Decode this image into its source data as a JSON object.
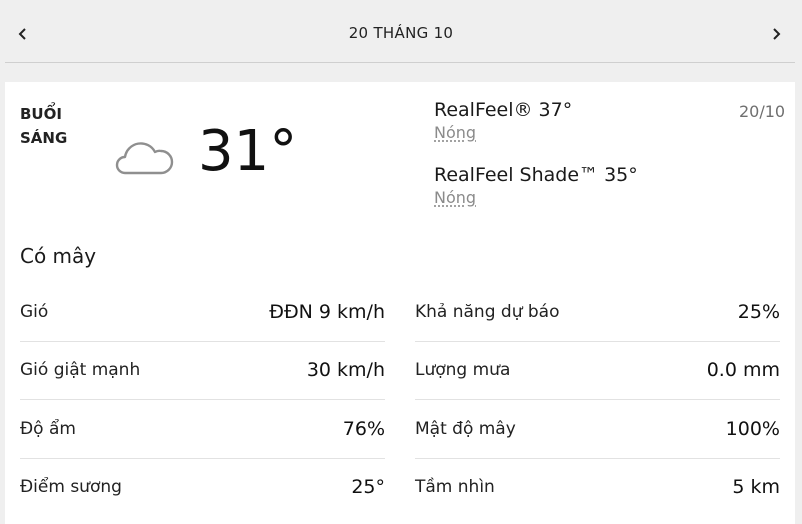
{
  "header": {
    "title": "20 THÁNG 10",
    "prev_icon": "chevron-left-icon",
    "next_icon": "chevron-right-icon"
  },
  "forecast": {
    "period_line1": "BUỔI",
    "period_line2": "SÁNG",
    "icon": "cloud-icon",
    "temperature": "31°",
    "realfeel_label": "RealFeel® 37°",
    "realfeel_desc": "Nóng",
    "realfeel_shade_label": "RealFeel Shade™ 35°",
    "realfeel_shade_desc": "Nóng",
    "date_short": "20/10",
    "condition": "Có mây"
  },
  "details": {
    "left": [
      {
        "label": "Gió",
        "value": "ĐĐN 9 km/h"
      },
      {
        "label": "Gió giật mạnh",
        "value": "30 km/h"
      },
      {
        "label": "Độ ẩm",
        "value": "76%"
      },
      {
        "label": "Điểm sương",
        "value": "25°"
      }
    ],
    "right": [
      {
        "label": "Khả năng dự báo",
        "value": "25%"
      },
      {
        "label": "Lượng mưa",
        "value": "0.0 mm"
      },
      {
        "label": "Mật độ mây",
        "value": "100%"
      },
      {
        "label": "Tầm nhìn",
        "value": "5 km"
      }
    ]
  },
  "colors": {
    "background": "#efefef",
    "card": "#ffffff",
    "muted_text": "#8b8b8b"
  }
}
